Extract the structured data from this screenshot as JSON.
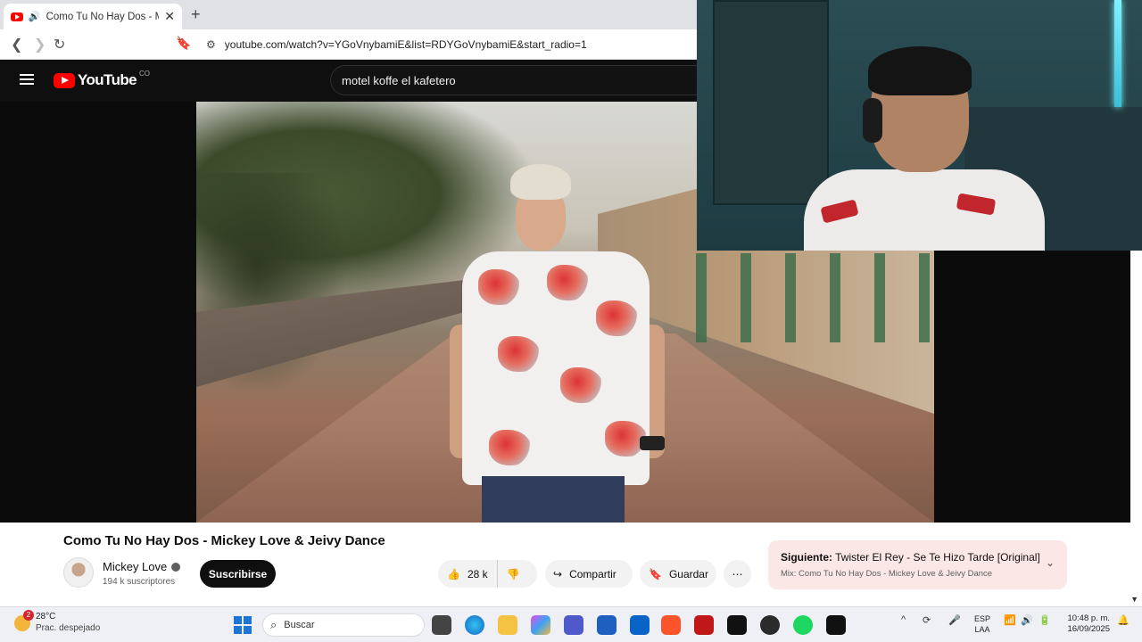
{
  "browser": {
    "tab_title": "Como Tu No Hay Dos - Mick",
    "tab_close": "✕",
    "new_tab": "+",
    "url": "youtube.com/watch?v=YGoVnybamiE&list=RDYGoVnybamiE&start_radio=1"
  },
  "youtube": {
    "logo_text": "YouTube",
    "country_code": "CO",
    "search_query": "motel koffe el kafetero",
    "video_title": "Como Tu No Hay Dos - Mickey Love & Jeivy Dance",
    "channel_name": "Mickey Love",
    "subscribers": "194 k suscriptores",
    "subscribe_label": "Suscribirse",
    "likes": "28 k",
    "share_label": "Compartir",
    "save_label": "Guardar",
    "more_label": "⋯",
    "next_prefix": "Siguiente:",
    "next_title": "Twister El Rey - Se Te Hizo Tarde [Original]",
    "next_mix": "Mix: Como Tu No Hay Dos - Mickey Love & Jeivy Dance"
  },
  "taskbar": {
    "weather_temp": "28°C",
    "weather_desc": "Prac. despejado",
    "weather_badge": "2",
    "search_placeholder": "Buscar",
    "lang_line1": "ESP",
    "lang_line2": "LAA",
    "time": "10:48 p. m.",
    "date": "16/09/2025"
  },
  "colors": {
    "youtube_red": "#ff0000",
    "header_bg": "#0f0f0f",
    "next_card_bg": "#fbe8e6",
    "taskbar_bg": "#eef0f5"
  }
}
